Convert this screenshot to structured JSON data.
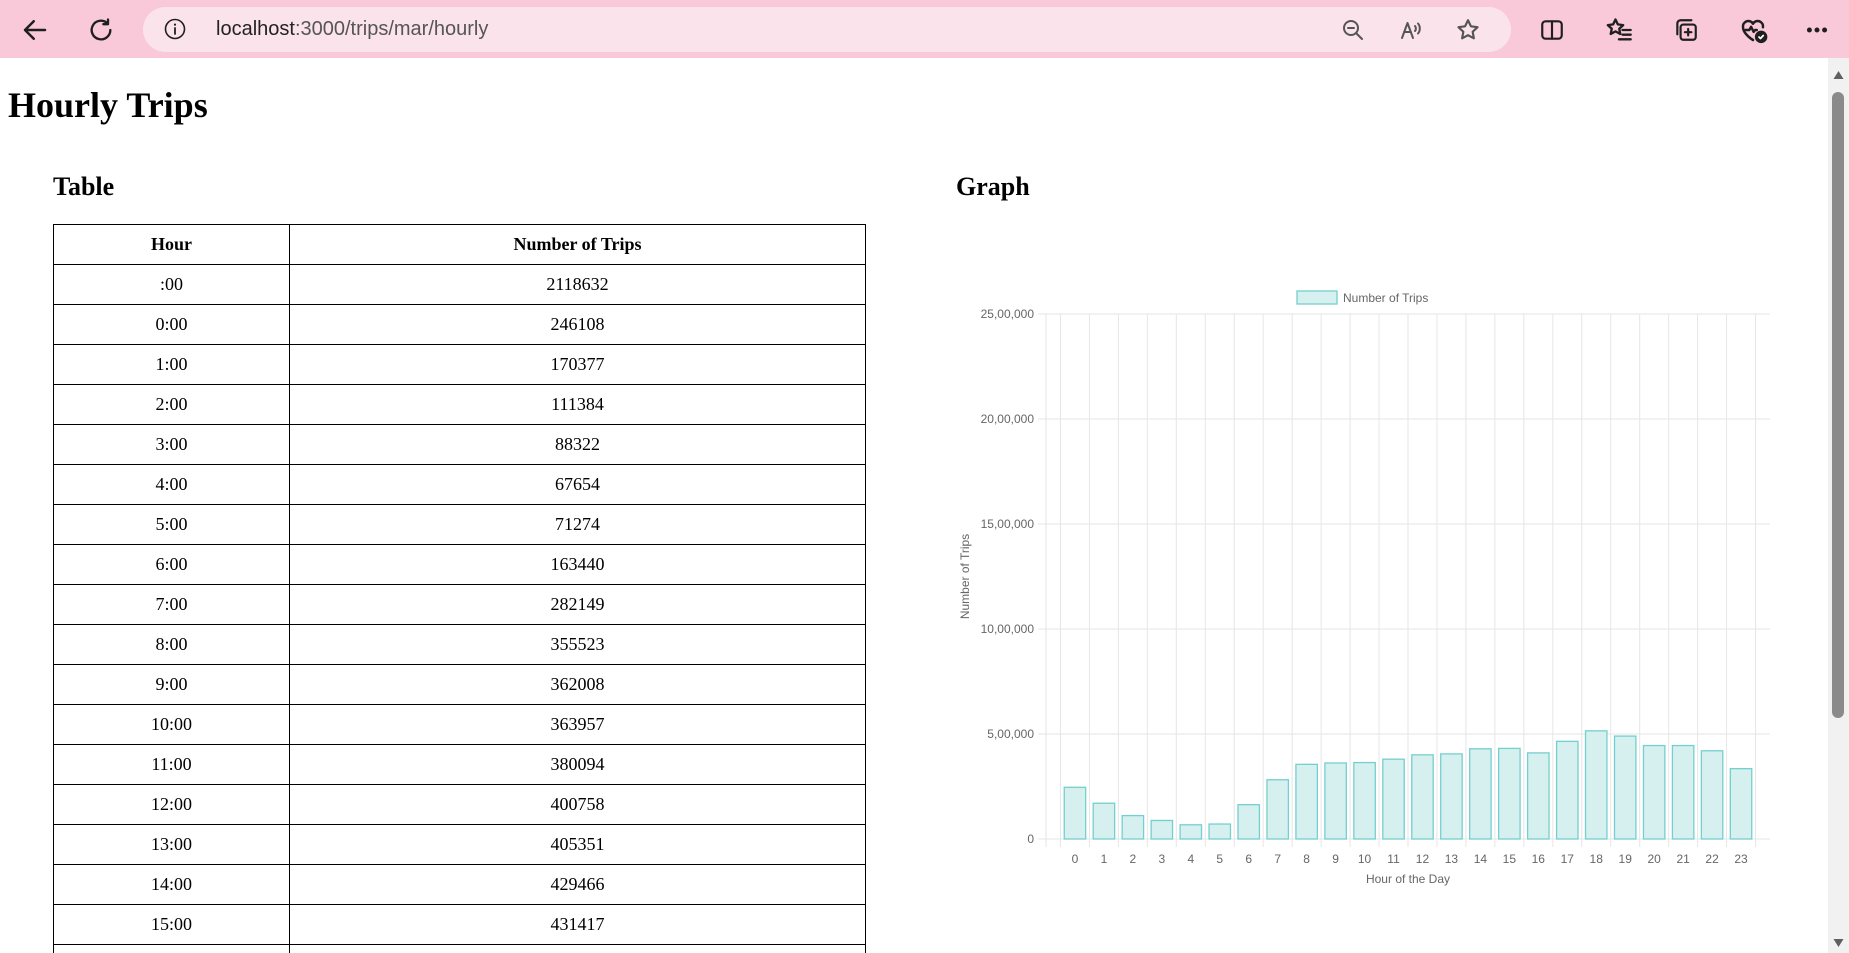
{
  "browser": {
    "url_host": "localhost",
    "url_rest": ":3000/trips/mar/hourly",
    "icons": [
      "back-icon",
      "refresh-icon",
      "info-icon",
      "zoom-out-icon",
      "read-aloud-icon",
      "favorite-star-icon",
      "split-screen-icon",
      "favorites-icon",
      "collections-icon",
      "browser-essentials-icon",
      "more-icon"
    ]
  },
  "page": {
    "title": "Hourly Trips",
    "table_heading": "Table",
    "graph_heading": "Graph"
  },
  "table": {
    "headers": [
      "Hour",
      "Number of Trips"
    ],
    "rows": [
      [
        ":00",
        "2118632"
      ],
      [
        "0:00",
        "246108"
      ],
      [
        "1:00",
        "170377"
      ],
      [
        "2:00",
        "111384"
      ],
      [
        "3:00",
        "88322"
      ],
      [
        "4:00",
        "67654"
      ],
      [
        "5:00",
        "71274"
      ],
      [
        "6:00",
        "163440"
      ],
      [
        "7:00",
        "282149"
      ],
      [
        "8:00",
        "355523"
      ],
      [
        "9:00",
        "362008"
      ],
      [
        "10:00",
        "363957"
      ],
      [
        "11:00",
        "380094"
      ],
      [
        "12:00",
        "400758"
      ],
      [
        "13:00",
        "405351"
      ],
      [
        "14:00",
        "429466"
      ],
      [
        "15:00",
        "431417"
      ],
      [
        "",
        ""
      ]
    ]
  },
  "chart_data": {
    "type": "bar",
    "categories": [
      "0",
      "1",
      "2",
      "3",
      "4",
      "5",
      "6",
      "7",
      "8",
      "9",
      "10",
      "11",
      "12",
      "13",
      "14",
      "15",
      "16",
      "17",
      "18",
      "19",
      "20",
      "21",
      "22",
      "23"
    ],
    "series": [
      {
        "name": "Number of Trips",
        "values": [
          246108,
          170377,
          111384,
          88322,
          67654,
          71274,
          163440,
          282149,
          355523,
          362008,
          363957,
          380094,
          400758,
          405351,
          429466,
          431417,
          410000,
          465000,
          515000,
          490000,
          445000,
          445000,
          420000,
          335000
        ]
      }
    ],
    "xlabel": "Hour of the Day",
    "ylabel": "Number of Trips",
    "ylim": [
      0,
      2500000
    ],
    "yticks": [
      0,
      500000,
      1000000,
      1500000,
      2000000,
      2500000
    ],
    "ytick_labels": [
      "0",
      "5,00,000",
      "10,00,000",
      "15,00,000",
      "20,00,000",
      "25,00,000"
    ],
    "grid": true,
    "legend": "top-center",
    "bar_fill": "#d6f0f0",
    "bar_stroke": "#74cfcf",
    "grid_color": "#e6e6e6"
  }
}
